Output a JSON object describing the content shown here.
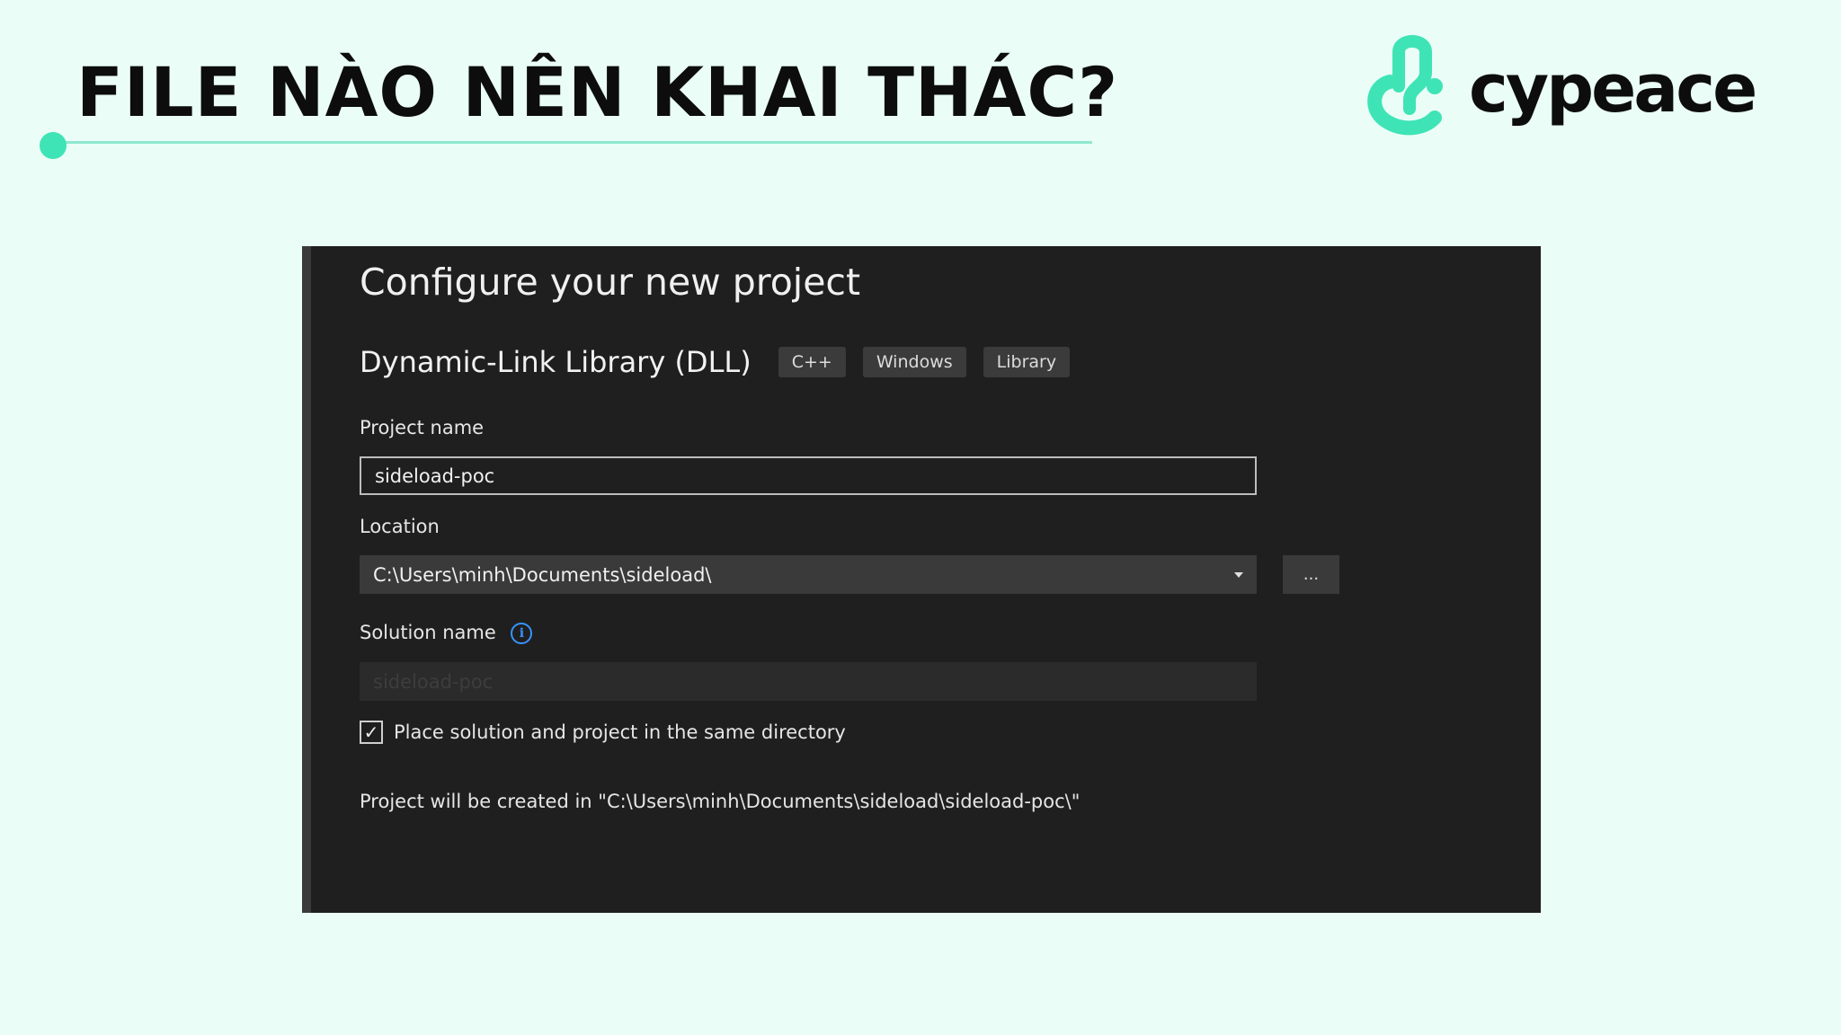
{
  "slide": {
    "title": "FILE NÀO NÊN KHAI THÁC?",
    "logo_text": "cypeace",
    "accent_color": "#3fe4b6",
    "background_color": "#eafdf7"
  },
  "dialog": {
    "heading": "Configure your new project",
    "template_name": "Dynamic-Link Library (DLL)",
    "tags": [
      "C++",
      "Windows",
      "Library"
    ],
    "project_name_label": "Project name",
    "project_name_value": "sideload-poc",
    "location_label": "Location",
    "location_value": "C:\\Users\\minh\\Documents\\sideload\\",
    "browse_label": "...",
    "solution_name_label": "Solution name",
    "solution_name_value": "sideload-poc",
    "same_directory_checked": true,
    "same_directory_label": "Place solution and project in the same directory",
    "creation_path_text": "Project will be created in \"C:\\Users\\minh\\Documents\\sideload\\sideload-poc\\\"",
    "icons": [
      "info-icon",
      "chevron-down-icon",
      "check-icon"
    ]
  }
}
